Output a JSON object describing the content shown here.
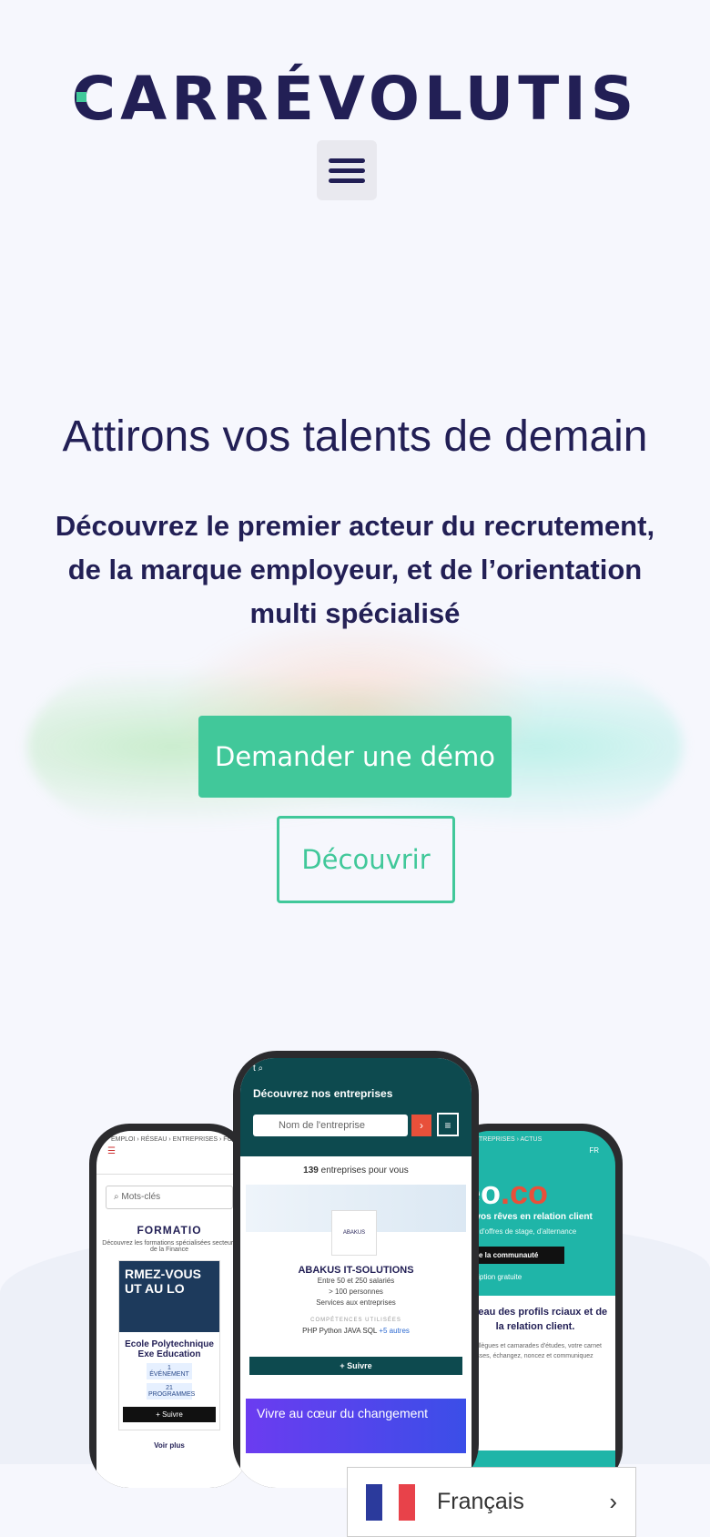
{
  "brand": {
    "logo_text": "CARRÉVOLUTIS",
    "accent": "#41c89a",
    "primary": "#221f55"
  },
  "header": {
    "menu_icon": "hamburger-icon"
  },
  "hero": {
    "title": "Attirons vos talents de demain",
    "subtitle": "Découvrez le premier acteur du recrutement, de la marque employeur, et de l’orientation multi spécialisé",
    "cta_primary": "Demander une démo",
    "cta_secondary": "Découvrir"
  },
  "phone_left": {
    "breadcrumb": "EMPLOI › RÉSEAU › ENTREPRISES › FORMATIONS",
    "search_placeholder": "Mots-clés",
    "section_title": "FORMATIO",
    "section_desc": "Découvrez les formations spécialisées secteurs de la Finance",
    "banner_text": "RMEZ-VOUS UT AU LO",
    "school_name": "Ecole Polytechnique Exe Education",
    "badge_events": "1 ÉVÉNEMENT",
    "badge_programs": "21 PROGRAMMES",
    "follow_label": "+ Suivre",
    "more_label": "Voir plus"
  },
  "phone_center": {
    "title": "Découvrez nos entreprises",
    "search_placeholder": "Nom de l'entreprise",
    "count_number": "139",
    "count_text": "entreprises pour vous",
    "company_logo": "ABAKUS",
    "company_name": "ABAKUS IT-SOLUTIONS",
    "info": [
      "Entre 50 et 250 salariés",
      "> 100 personnes",
      "Services aux entreprises"
    ],
    "skills_title": "COMPÉTENCES UTILISÉES",
    "skills": "PHP  Python  JAVA  SQL",
    "skills_more": "+5 autres",
    "follow_label": "+ Suivre",
    "promo_text": "Vivre au cœur du changement"
  },
  "phone_right": {
    "breadcrumb": "› ENTREPRISES › ACTUS",
    "top_right": "FR",
    "brand_text": "eo",
    "brand_suffix": ".co",
    "tagline": "de vos rêves en relation client",
    "desc": "lliers d'offres de stage, d'alternance",
    "join_label": "oindre la communauté",
    "register_label": "nscription gratuite",
    "card_title": "réseau des profils rciaux et de la relation client.",
    "card_desc": "otre collègues et camarades d'études, votre carnet d'adresses, échangez, noncez et communiquez"
  },
  "language": {
    "label": "Français",
    "flag_colors": [
      "#2b3a9c",
      "#ffffff",
      "#e8424a"
    ]
  }
}
